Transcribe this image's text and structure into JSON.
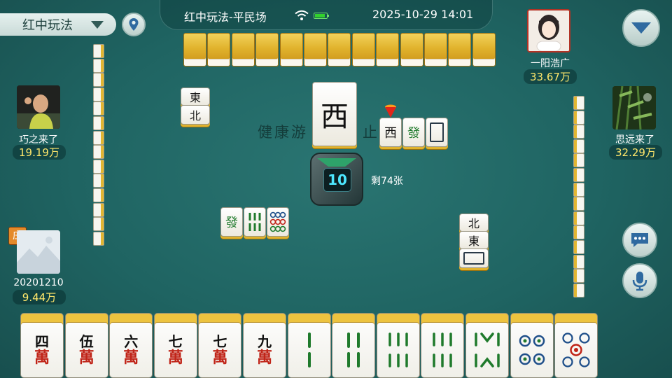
{
  "topbar": {
    "rule_label": "红中玩法",
    "room_title": "红中玩法-平民场",
    "datetime": "2025-10-29 14:01"
  },
  "players": {
    "top": {
      "name": "一阳浩广",
      "score": "33.67万"
    },
    "left": {
      "name": "巧之来了",
      "score": "19.19万"
    },
    "right": {
      "name": "思远来了",
      "score": "32.29万"
    },
    "self": {
      "name": "20201210",
      "score": "9.44万",
      "dealer_badge": "庄"
    }
  },
  "table": {
    "center_tile": "西",
    "watermark_left": "健康游",
    "watermark_right": "止",
    "timer": "10",
    "remaining": "剩74张"
  },
  "discards": {
    "right_player": [
      "西",
      "發",
      "白"
    ],
    "left_player": [
      "東",
      "北"
    ],
    "bottom": [
      "發",
      "六条",
      "九筒"
    ],
    "side_right": [
      "北",
      "東",
      "白"
    ]
  },
  "hand": [
    {
      "num": "四",
      "suit": "萬"
    },
    {
      "num": "伍",
      "suit": "萬"
    },
    {
      "num": "六",
      "suit": "萬"
    },
    {
      "num": "七",
      "suit": "萬"
    },
    {
      "num": "七",
      "suit": "萬"
    },
    {
      "num": "九",
      "suit": "萬"
    },
    {
      "label": "二条"
    },
    {
      "label": "四条"
    },
    {
      "label": "六条"
    },
    {
      "label": "六条"
    },
    {
      "label": "八条"
    },
    {
      "label": "四筒"
    },
    {
      "label": "五筒"
    }
  ],
  "colors": {
    "felt": "#1f6462",
    "tile_gold": "#e1b32d",
    "score": "#ffe76b",
    "timer": "#4de7ff"
  },
  "icons": [
    "chevron-down-icon",
    "location-pin-icon",
    "wifi-icon",
    "battery-icon",
    "menu-down-icon",
    "chat-bubble-icon",
    "microphone-icon",
    "turn-arrow-icon"
  ]
}
